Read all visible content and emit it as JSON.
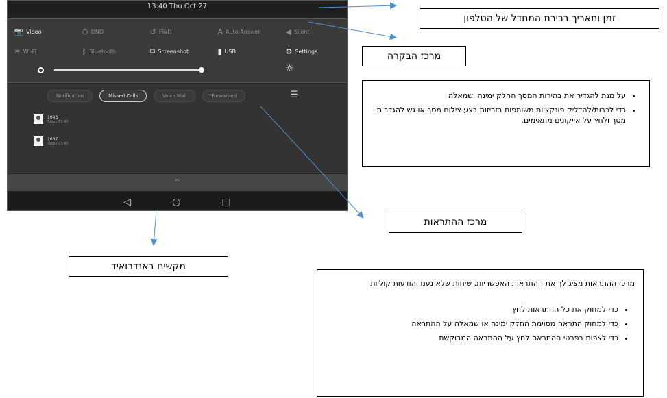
{
  "phone": {
    "status_time": "13:40 Thu Oct 27",
    "quick_settings": {
      "row1": [
        {
          "label": "Video",
          "icon": "camera-icon",
          "on": true
        },
        {
          "label": "DND",
          "icon": "minus-circle-icon",
          "on": false
        },
        {
          "label": "FWD",
          "icon": "forward-icon",
          "on": false
        },
        {
          "label": "Auto Answer",
          "icon": "auto-answer-icon",
          "on": false
        },
        {
          "label": "Silent",
          "icon": "speaker-icon",
          "on": false
        }
      ],
      "row2": [
        {
          "label": "Wi-Fi",
          "icon": "wifi-icon",
          "on": false
        },
        {
          "label": "Bluetooth",
          "icon": "bluetooth-icon",
          "on": false
        },
        {
          "label": "Screenshot",
          "icon": "screenshot-icon",
          "on": true
        },
        {
          "label": "USB",
          "icon": "usb-icon",
          "on": true
        },
        {
          "label": "Settings",
          "icon": "gear-icon",
          "on": true
        }
      ],
      "brightness_level": 1.0
    },
    "notification_tabs": [
      "Notification",
      "Missed Calls",
      "Voice Mail",
      "Forwarded"
    ],
    "active_tab": "Missed Calls",
    "notifications": [
      {
        "number": "1645",
        "time": "Today 13:40"
      },
      {
        "number": "1637",
        "time": "Today 13:40"
      }
    ],
    "collapse_icon": "chevron-up-icon",
    "nav": {
      "back": "◁",
      "home": "○",
      "recents": "□"
    }
  },
  "annotations": {
    "time_box": "זמן ותאריך ברירת המחדל של הטלפון",
    "control_center": "מרכז הבקרה",
    "control_bullets": [
      "על מנת להגדיר את בהירות המסך החלק ימינה ושמאלה",
      "כדי לכבות/להדליק פונקציות משותפות בזריזות בצע צילום מסך או גש להגדרות מסך ולחץ על אייקונים מתאימים."
    ],
    "notification_center": "מרכז ההתראות",
    "android_keys": "מקשים באנדרואיד",
    "notif_intro": "מרכז ההתראות מציג לך את ההתראות האפשריות, שיחות שלא נענו והודעות קוליות",
    "notif_bullets": [
      "כדי למחוק את כל ההתראות לחץ",
      "כדי למחוק התראה מסוימת החלק ימינה או שמאלה על ההתראה",
      "כדי לצפות בפרטי ההתראה לחץ על ההתראה המבוקשת"
    ]
  }
}
